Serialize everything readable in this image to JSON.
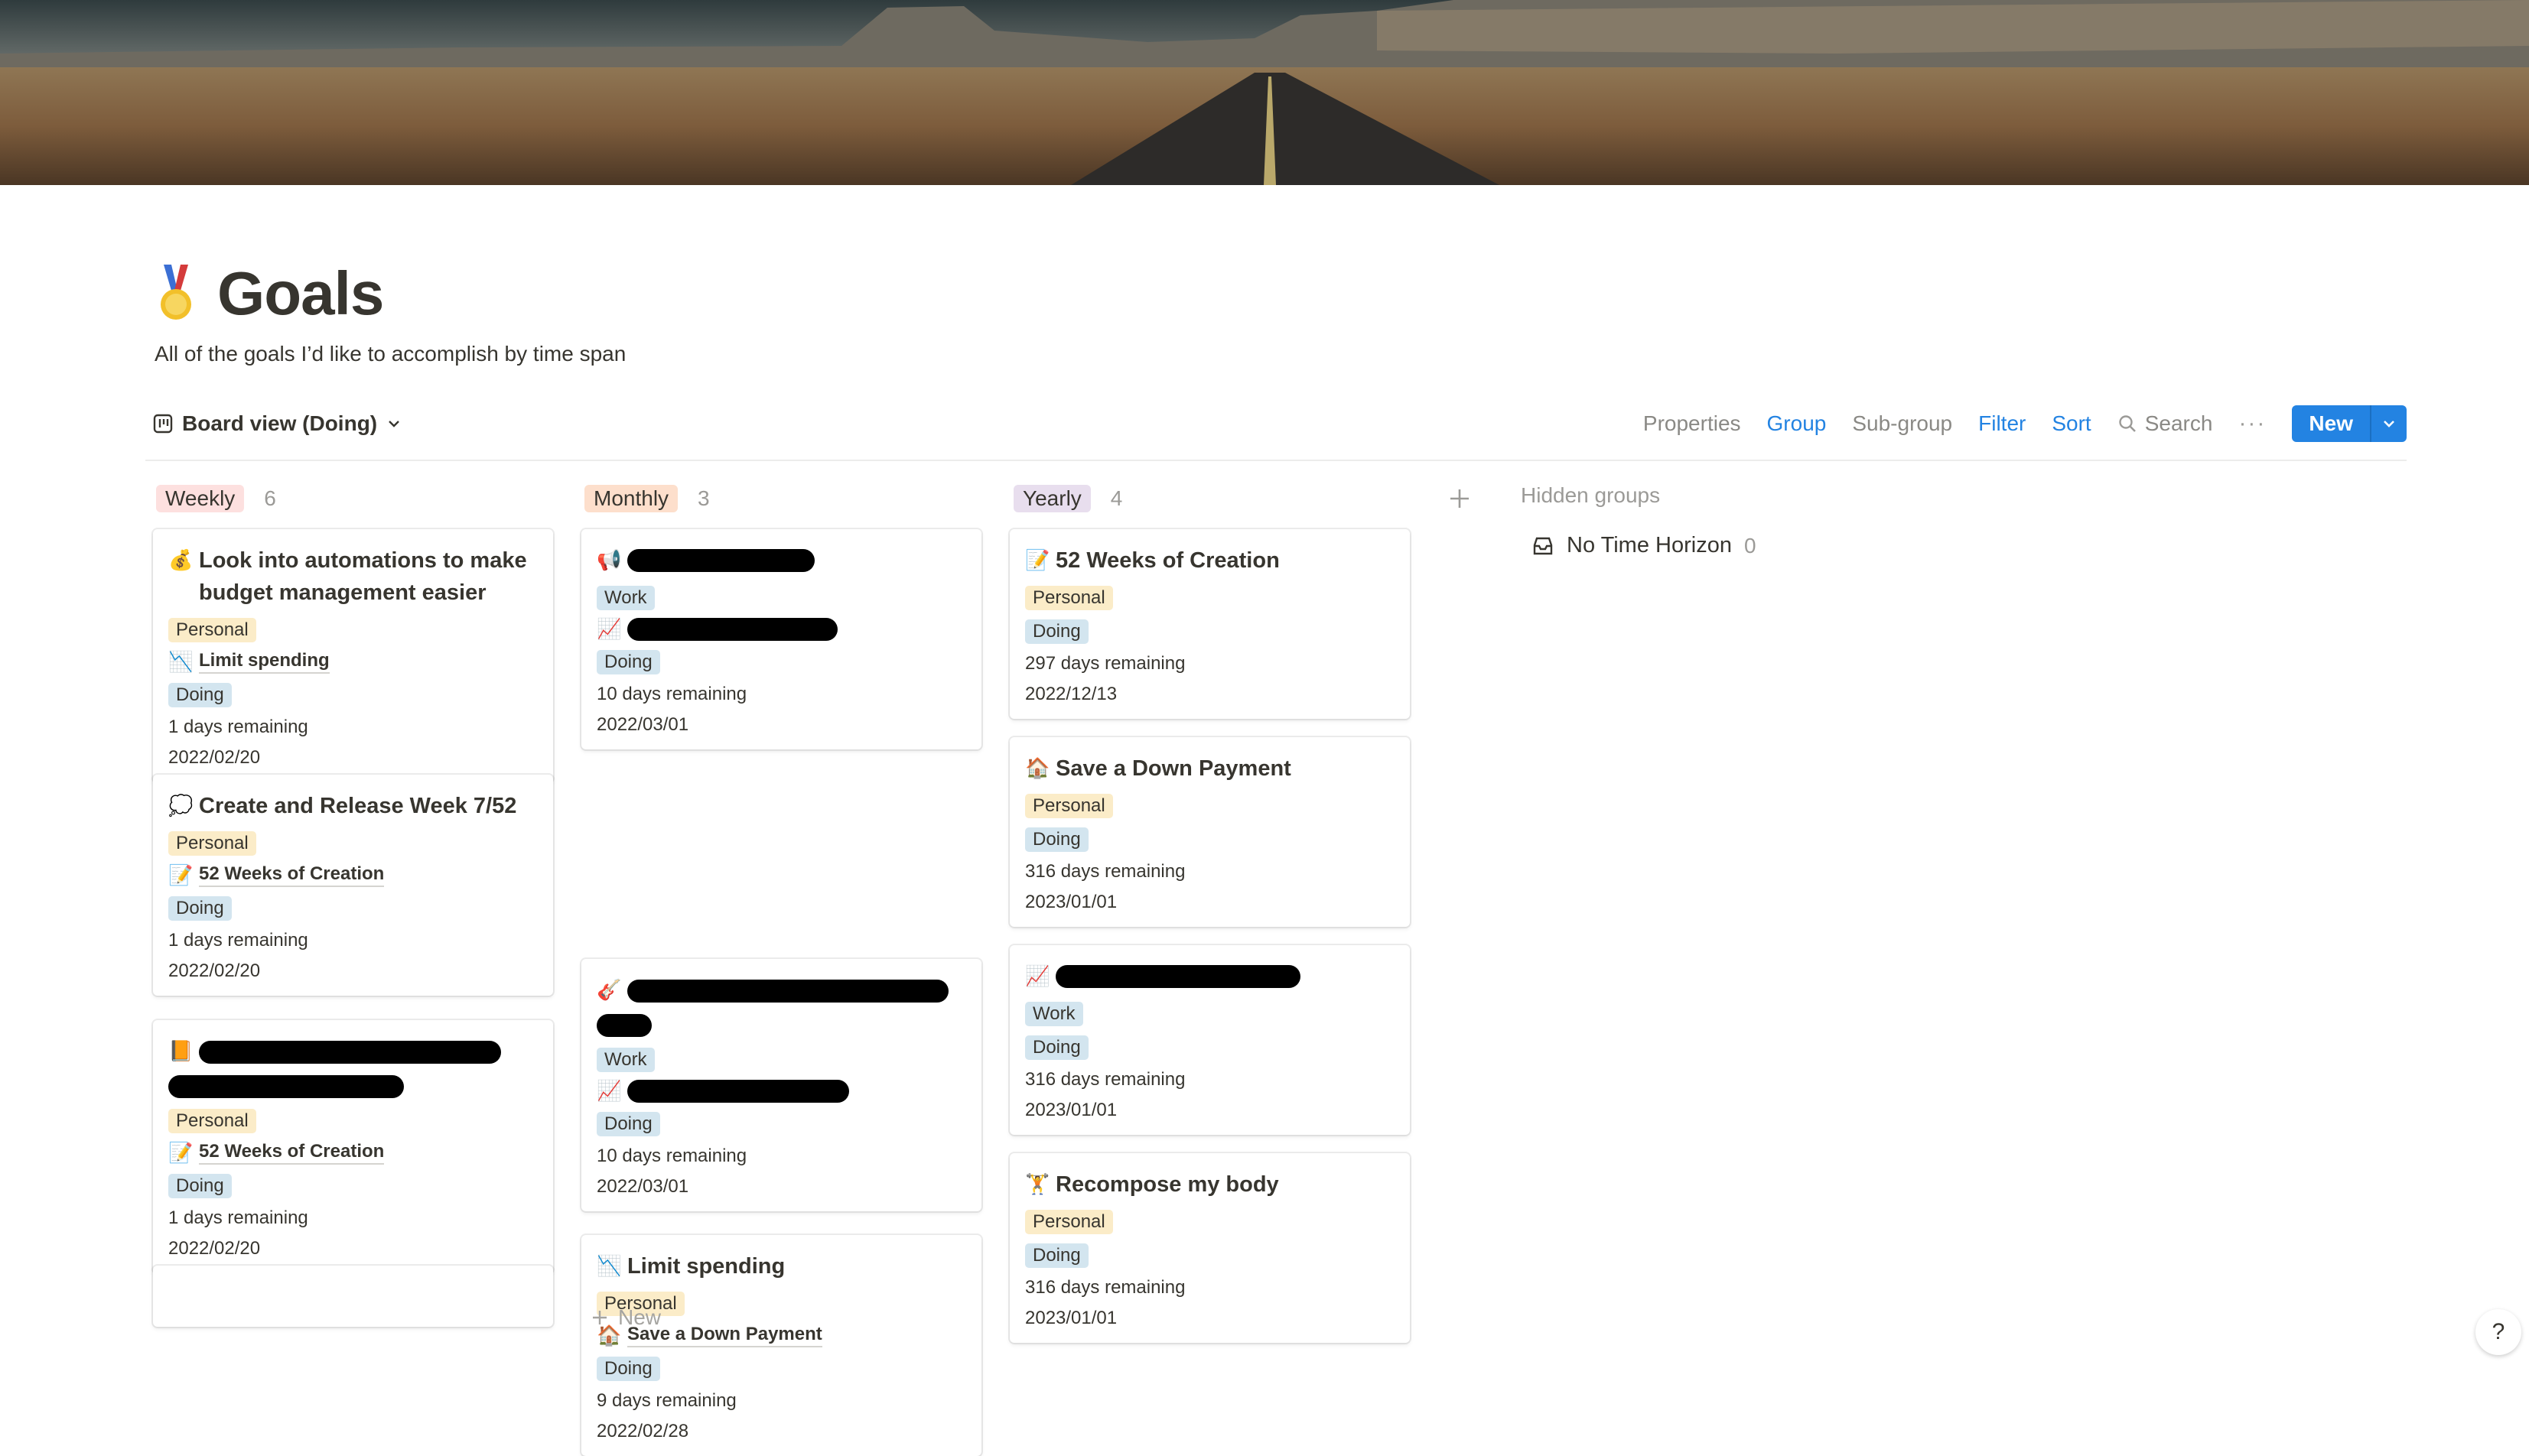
{
  "page": {
    "title": "Goals",
    "description": "All of the goals I’d like to accomplish by time span"
  },
  "view": {
    "label": "Board view (Doing)",
    "tools": {
      "properties": "Properties",
      "group": "Group",
      "subgroup": "Sub-group",
      "filter": "Filter",
      "sort": "Sort",
      "search": "Search",
      "more": "···",
      "new": "New"
    }
  },
  "colors": {
    "accent": "#2383e2",
    "weekly": "#fde0df",
    "monthly": "#fddfcc",
    "yearly": "#e8deee",
    "personal": "#fbecc8",
    "work_doing": "#d3e5ef"
  },
  "groups": [
    {
      "label": "Weekly",
      "count": "6",
      "cards": [
        {
          "title": "Look into automations to make budget management easier",
          "icon": "money-bag",
          "tag": "Personal",
          "relation_icon": "chart-down",
          "relation": "Limit spending",
          "status": "Doing",
          "remaining": "1 days remaining",
          "date": "2022/02/20"
        },
        {
          "title": "Create and Release Week 7/52",
          "icon": "thought-bubble",
          "tag": "Personal",
          "relation_icon": "memo",
          "relation": "52 Weeks of Creation",
          "status": "Doing",
          "remaining": "1 days remaining",
          "date": "2022/02/20"
        },
        {
          "title": "",
          "icon": "orange-book",
          "tag": "Personal",
          "relation_icon": "memo",
          "relation": "52 Weeks of Creation",
          "status": "Doing",
          "remaining": "1 days remaining",
          "date": "2022/02/20"
        }
      ]
    },
    {
      "label": "Monthly",
      "count": "3",
      "cards": [
        {
          "title": "",
          "icon": "megaphone",
          "tag": "Work",
          "relation_icon": "chart-up",
          "relation": "",
          "status": "Doing",
          "remaining": "10 days remaining",
          "date": "2022/03/01"
        },
        {
          "title": "",
          "icon": "guitar",
          "tag": "Work",
          "relation_icon": "chart-up",
          "relation": "",
          "status": "Doing",
          "remaining": "10 days remaining",
          "date": "2022/03/01"
        },
        {
          "title": "Limit spending",
          "icon": "chart-down",
          "tag": "Personal",
          "relation_icon": "house",
          "relation": "Save a Down Payment",
          "status": "Doing",
          "remaining": "9 days remaining",
          "date": "2022/02/28"
        }
      ],
      "new_label": "New"
    },
    {
      "label": "Yearly",
      "count": "4",
      "cards": [
        {
          "title": "52 Weeks of Creation",
          "icon": "memo",
          "tag": "Personal",
          "status": "Doing",
          "remaining": "297 days remaining",
          "date": "2022/12/13"
        },
        {
          "title": "Save a Down Payment",
          "icon": "house",
          "tag": "Personal",
          "status": "Doing",
          "remaining": "316 days remaining",
          "date": "2023/01/01"
        },
        {
          "title": "",
          "icon": "chart-up",
          "tag": "Work",
          "status": "Doing",
          "remaining": "316 days remaining",
          "date": "2023/01/01"
        },
        {
          "title": "Recompose my body",
          "icon": "weight-lifter",
          "tag": "Personal",
          "status": "Doing",
          "remaining": "316 days remaining",
          "date": "2023/01/01"
        }
      ]
    }
  ],
  "hidden": {
    "title": "Hidden groups",
    "items": [
      {
        "label": "No Time Horizon",
        "count": "0"
      }
    ]
  },
  "help": "?"
}
